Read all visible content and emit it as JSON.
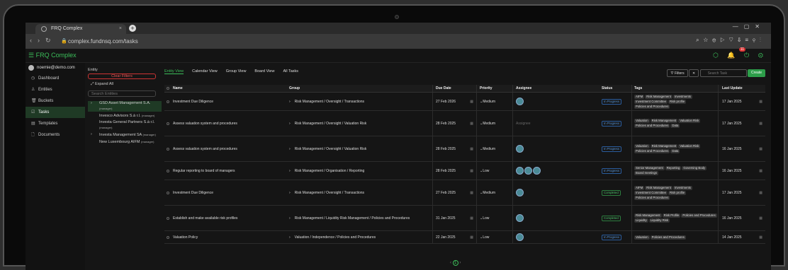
{
  "browser": {
    "tab_title": "FRQ Complex",
    "url": "complex.fundnsq.com/tasks"
  },
  "app": {
    "brand": "FRQ Complex",
    "notif_count": "11"
  },
  "user": {
    "email": "noemie@demo.com"
  },
  "nav": [
    {
      "label": "Dashboard",
      "icon": "dashboard-icon"
    },
    {
      "label": "Entities",
      "icon": "entities-icon"
    },
    {
      "label": "Buckets",
      "icon": "bucket-icon"
    },
    {
      "label": "Tasks",
      "icon": "tasks-icon"
    },
    {
      "label": "Templates",
      "icon": "template-icon"
    },
    {
      "label": "Documents",
      "icon": "document-icon"
    }
  ],
  "entity_panel": {
    "label": "Entity",
    "clear": "Clear Filters",
    "expand": "Expand All",
    "search_placeholder": "Search Entities",
    "tree": [
      {
        "name": "GSD Asset Management S.A.",
        "role": "(manager)"
      },
      {
        "name": "Invesco Advisors S.à r.l.",
        "role": "(manager)"
      },
      {
        "name": "Investa General Partners S.à r.l.",
        "role": "(manager)"
      },
      {
        "name": "Investa Management SA",
        "role": "(manager)"
      },
      {
        "name": "New Luxembourg AIFM",
        "role": "(manager)"
      }
    ]
  },
  "views": [
    "Entity View",
    "Calendar View",
    "Group View",
    "Board View",
    "All Tasks"
  ],
  "toolbar": {
    "filters": "Filters",
    "search_placeholder": "Search Task",
    "create": "Create"
  },
  "columns": {
    "name": "Name",
    "group": "Group",
    "due": "Due Date",
    "priority": "Priority",
    "assignee": "Assignee",
    "status": "Status",
    "tags": "Tags",
    "updated": "Last Update"
  },
  "rows": [
    {
      "name": "Investment Due Diligence",
      "group": "Risk Management / Oversight / Transactions",
      "due": "27 Feb 2026",
      "priority": "Medium",
      "status": "In Progress",
      "tags": [
        "AIFM",
        "Risk Management",
        "Investments",
        "Investment Committee",
        "Risk profile",
        "Policies and Procedures"
      ],
      "updated": "17 Jan 2025"
    },
    {
      "name": "Assess valuation system and procedures",
      "group": "Risk Management / Oversight / Valuation Risk",
      "due": "28 Feb 2025",
      "priority": "Medium",
      "status": "In Progress",
      "tags": [
        "Valuation",
        "Risk Management",
        "Valuation Risk",
        "Policies and Procedures",
        "Data"
      ],
      "updated": "17 Jan 2025"
    },
    {
      "name": "Assess valuation system and procedures",
      "group": "Risk Management / Oversight / Valuation Risk",
      "due": "28 Feb 2025",
      "priority": "Medium",
      "status": "In Progress",
      "tags": [
        "Valuation",
        "Risk Management",
        "Valuation Risk",
        "Policies and Procedures",
        "Data"
      ],
      "updated": "16 Jan 2025"
    },
    {
      "name": "Regular reporting to board of managers",
      "group": "Risk Management / Organisation / Reporting",
      "due": "28 Feb 2025",
      "priority": "Low",
      "status": "In Progress",
      "tags": [
        "Senior Management",
        "Reporting",
        "Governing Body",
        "Board meetings"
      ],
      "updated": "16 Jan 2025"
    },
    {
      "name": "Investment Due Diligence",
      "group": "Risk Management / Oversight / Transactions",
      "due": "27 Feb 2025",
      "priority": "Medium",
      "status": "Completed",
      "tags": [
        "AIFM",
        "Risk Management",
        "Investments",
        "Investment Committee",
        "Risk profile",
        "Policies and Procedures"
      ],
      "updated": "17 Jan 2025"
    },
    {
      "name": "Establish and make available risk profiles",
      "group": "Risk Management / Liquidity Risk Management / Policies and Procedures",
      "due": "31 Jan 2025",
      "priority": "Low",
      "status": "Completed",
      "tags": [
        "Risk Management",
        "Risk Profile",
        "Policies and Procedures",
        "Liquidity",
        "Liquidity Risk"
      ],
      "updated": "16 Jan 2025"
    },
    {
      "name": "Valuation Policy",
      "group": "Valuation / Independence / Policies and Procedures",
      "due": "22 Jan 2025",
      "priority": "Low",
      "status": "In Progress",
      "tags": [
        "Valuation",
        "Policies and Procedures"
      ],
      "updated": "14 Jan 2025"
    }
  ],
  "assignee_placeholder": "Assignee",
  "pager": {
    "page": "1"
  }
}
